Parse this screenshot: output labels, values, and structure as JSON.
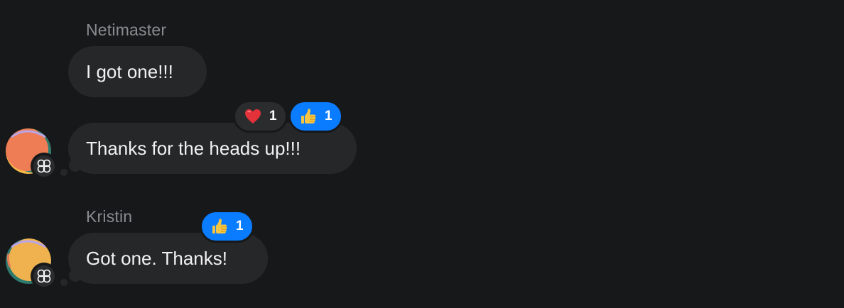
{
  "colors": {
    "background": "#17181a",
    "bubble": "#262729",
    "sender_name": "#8a8b8e",
    "reaction_mine": "#0a7cff",
    "reaction_other": "#2b2c2e"
  },
  "messages": [
    {
      "sender": "Netimaster",
      "text": "I got one!!!",
      "reactions": []
    },
    {
      "sender": "",
      "text": "Thanks for the heads up!!!",
      "avatar": "orange-avatar",
      "reactions": [
        {
          "emoji": "heart-emoji",
          "count": "1",
          "mine": false
        },
        {
          "emoji": "thumbs-up-emoji",
          "count": "1",
          "mine": true
        }
      ]
    },
    {
      "sender": "Kristin",
      "text": "Got one. Thanks!",
      "avatar": "yellow-avatar",
      "reactions": [
        {
          "emoji": "thumbs-up-emoji",
          "count": "1",
          "mine": true
        }
      ]
    }
  ]
}
